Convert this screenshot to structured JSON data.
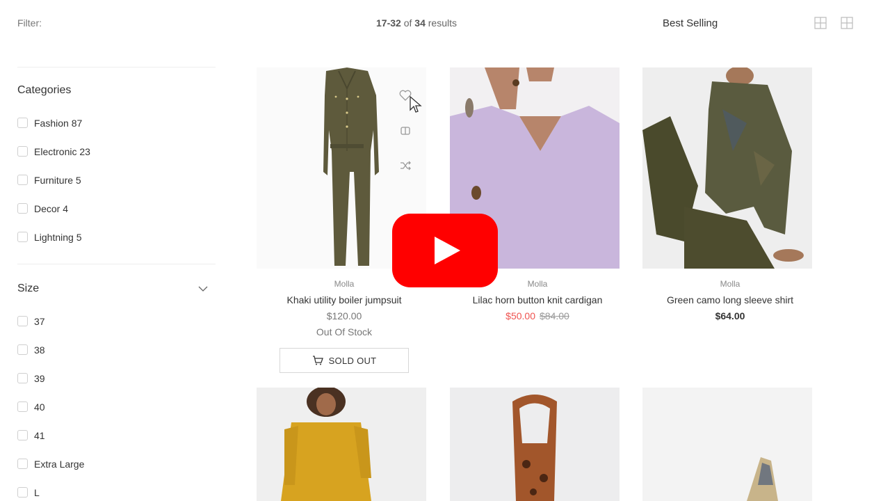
{
  "toolbar": {
    "filter_label": "Filter:",
    "results_range": "17-32",
    "results_of": "of",
    "results_total": "34",
    "results_word": "results",
    "sort_label": "Best Selling",
    "view_icons": [
      "grid-2-icon",
      "grid-4-icon"
    ]
  },
  "sidebar": {
    "categories_title": "Categories",
    "categories": [
      {
        "label": "Fashion 87"
      },
      {
        "label": "Electronic 23"
      },
      {
        "label": "Furniture 5"
      },
      {
        "label": "Decor 4"
      },
      {
        "label": "Lightning 5"
      }
    ],
    "size_title": "Size",
    "sizes": [
      {
        "label": "37"
      },
      {
        "label": "38"
      },
      {
        "label": "39"
      },
      {
        "label": "40"
      },
      {
        "label": "41"
      },
      {
        "label": "Extra Large"
      },
      {
        "label": "L"
      }
    ]
  },
  "products": [
    {
      "brand": "Molla",
      "name": "Khaki utility boiler jumpsuit",
      "price": "$120.00",
      "stock": "Out Of Stock",
      "button": "SOLD OUT"
    },
    {
      "brand": "Molla",
      "name": "Lilac horn button knit cardigan",
      "sale_price": "$50.00",
      "old_price": "$84.00"
    },
    {
      "brand": "Molla",
      "name": "Green camo long sleeve shirt",
      "price": "$64.00"
    }
  ],
  "product_actions": [
    "heart-icon",
    "compare-icon",
    "shuffle-icon"
  ],
  "colors": {
    "sale": "#ef5350",
    "play_button": "#ff0000"
  },
  "overlay": {
    "icon": "youtube-play-icon"
  }
}
